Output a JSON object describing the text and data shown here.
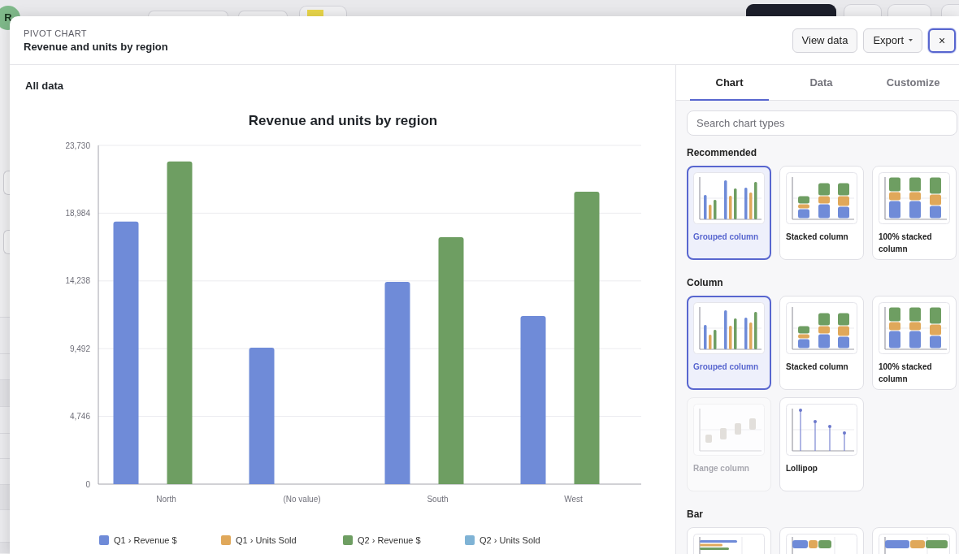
{
  "backdrop": {
    "avatar_initial": "R"
  },
  "dialog": {
    "eyebrow": "PIVOT CHART",
    "title": "Revenue and units by region",
    "buttons": [
      {
        "label": "View data",
        "kind": "plain",
        "focused": false
      },
      {
        "label": "Export",
        "kind": "menu",
        "focused": false
      },
      {
        "label": "×",
        "kind": "close",
        "focused": true
      }
    ]
  },
  "chart_area": {
    "scope_label": "All data",
    "chart_data": {
      "type": "bar",
      "title": "Revenue and units by region",
      "categories": [
        "North",
        "(No value)",
        "South",
        "West"
      ],
      "series": [
        {
          "name": "Q1 › Revenue $",
          "color": "#6f8bd8",
          "values": [
            18400,
            9560,
            14170,
            11780
          ]
        },
        {
          "name": "Q1 › Units Sold",
          "color": "#e0a85a",
          "values": [
            0,
            0,
            0,
            0
          ]
        },
        {
          "name": "Q2 › Revenue $",
          "color": "#6e9e62",
          "values": [
            22600,
            0,
            17300,
            20490
          ]
        },
        {
          "name": "Q2 › Units Sold",
          "color": "#7fb3d5",
          "values": [
            0,
            0,
            0,
            0
          ]
        }
      ],
      "ylim": [
        0,
        23730
      ],
      "yticks": [
        {
          "value": 0,
          "label": "0"
        },
        {
          "value": 4746,
          "label": "4,746"
        },
        {
          "value": 9492,
          "label": "9,492"
        },
        {
          "value": 14238,
          "label": "14,238"
        },
        {
          "value": 18984,
          "label": "18,984"
        },
        {
          "value": 23730,
          "label": "23,730"
        }
      ],
      "grid": true,
      "legend": "bottom"
    }
  },
  "side_panel": {
    "tabs": [
      {
        "label": "Chart",
        "selected": true
      },
      {
        "label": "Data",
        "selected": false
      },
      {
        "label": "Customize",
        "selected": false
      }
    ],
    "search": {
      "placeholder": "Search chart types"
    },
    "sections": [
      {
        "title": "Recommended",
        "items": [
          {
            "kind": "grouped",
            "label": "Grouped column",
            "selected": true,
            "disabled": false
          },
          {
            "kind": "stacked",
            "label": "Stacked column",
            "selected": false,
            "disabled": false
          },
          {
            "kind": "stacked100",
            "label": "100% stacked column",
            "selected": false,
            "disabled": false
          }
        ]
      },
      {
        "title": "Column",
        "items": [
          {
            "kind": "grouped",
            "label": "Grouped column",
            "selected": true,
            "disabled": false
          },
          {
            "kind": "stacked",
            "label": "Stacked column",
            "selected": false,
            "disabled": false
          },
          {
            "kind": "stacked100",
            "label": "100% stacked column",
            "selected": false,
            "disabled": false
          },
          {
            "kind": "range",
            "label": "Range column",
            "selected": false,
            "disabled": true
          },
          {
            "kind": "lollipop",
            "label": "Lollipop",
            "selected": false,
            "disabled": false
          }
        ]
      },
      {
        "title": "Bar",
        "items": [
          {
            "kind": "bar_grouped",
            "selected": false,
            "disabled": false
          },
          {
            "kind": "bar_stacked",
            "selected": false,
            "disabled": false
          },
          {
            "kind": "bar_stacked100",
            "selected": false,
            "disabled": false
          }
        ]
      }
    ]
  }
}
